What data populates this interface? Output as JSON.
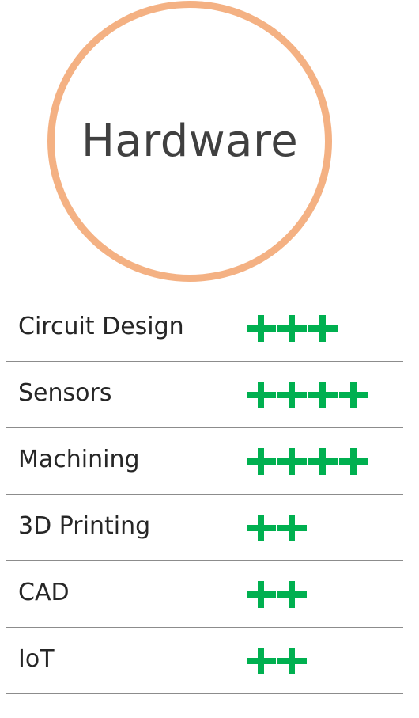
{
  "title": "Hardware",
  "colors": {
    "ring": "#f4b183",
    "plus": "#00b050",
    "divider": "#8c8c8c"
  },
  "rating_symbol": "plus-icon",
  "skills": [
    {
      "label": "Circuit Design",
      "rating": 3
    },
    {
      "label": "Sensors",
      "rating": 4
    },
    {
      "label": "Machining",
      "rating": 4
    },
    {
      "label": "3D Printing",
      "rating": 2
    },
    {
      "label": "CAD",
      "rating": 2
    },
    {
      "label": "IoT",
      "rating": 2
    }
  ]
}
